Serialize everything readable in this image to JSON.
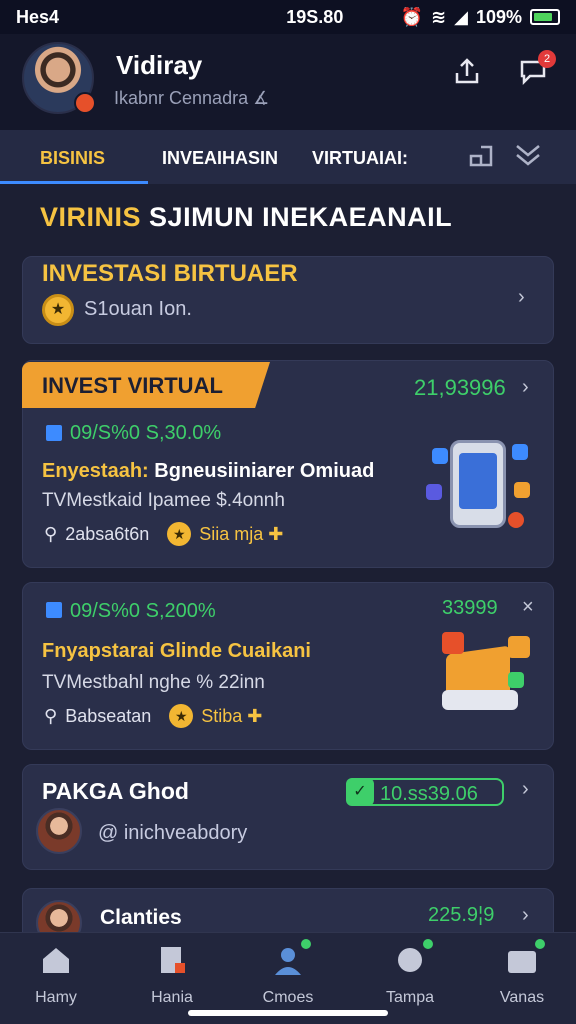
{
  "status": {
    "time": "Hes4",
    "center": "19S.80",
    "battery": "109%"
  },
  "header": {
    "name": "Vidiray",
    "subtitle": "Ikabnr Cennadra ∡",
    "share_icon": "share-icon",
    "chat_icon": "chat-icon",
    "chat_badge": "2"
  },
  "tabs": [
    {
      "label": "BISINIS",
      "active": true
    },
    {
      "label": "INVEAIHASIN",
      "active": false
    },
    {
      "label": "VIRTUAIAI:",
      "active": false
    }
  ],
  "section": {
    "title_yellow": "VIRINIS",
    "title_white": "SJIMUN INEKAEANAIL"
  },
  "card1": {
    "title": "INVESTASI BIRTUAER",
    "coin_glyph": "★",
    "sub": "S1ouan Ion."
  },
  "card2": {
    "ribbon": "INVEST VIRTUAL",
    "amount": "21,93996",
    "pct": "09/S%0 S,30.0%",
    "title_yellow": "Enyestaah:",
    "title_white": "Bgneusiiniarer Omiuad",
    "sub": "TVMestkaid Ipamee $.4onnh",
    "meta": "2absa6t6n",
    "tag": "Siia mja ✚"
  },
  "card3": {
    "amount": "33999",
    "pct": "09/S%0 S,200%",
    "title": "Fnyapstarai Glinde Cuaikani",
    "sub": "TVMestbahl nghe % 22inn",
    "meta": "Babseatan",
    "tag": "Stiba ✚"
  },
  "card4": {
    "title": "PAKGA Ghod",
    "handle": "@ inichveabdory",
    "badge": "10.ss39.06"
  },
  "card5": {
    "title": "Clanties",
    "amount": "225.9¦9"
  },
  "nav": [
    {
      "label": "Hamy",
      "icon": "home-icon"
    },
    {
      "label": "Hania",
      "icon": "document-icon"
    },
    {
      "label": "Cmoes",
      "icon": "people-icon"
    },
    {
      "label": "Tampa",
      "icon": "globe-icon"
    },
    {
      "label": "Vanas",
      "icon": "wallet-icon"
    }
  ],
  "colors": {
    "accent": "#f6c342",
    "green": "#3ecf6a",
    "ribbon": "#f0a030",
    "tab_underline": "#3d8bff"
  }
}
